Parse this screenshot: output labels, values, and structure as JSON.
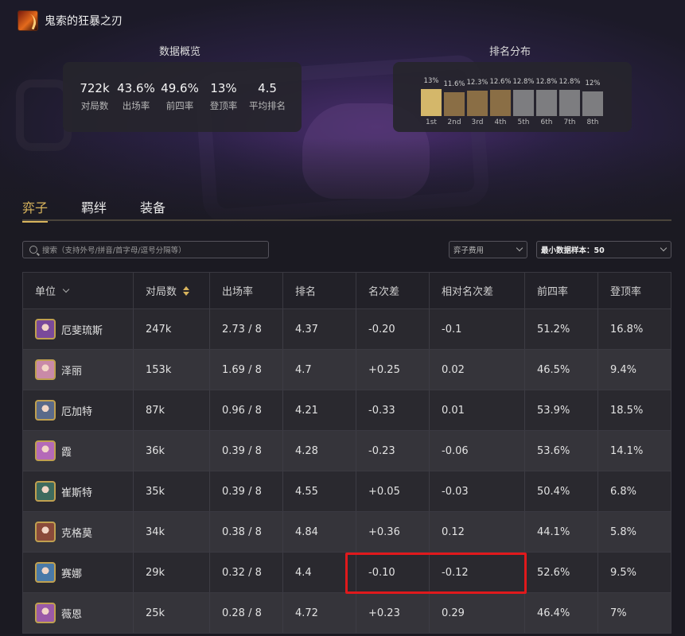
{
  "header": {
    "item_name": "鬼索的狂暴之刃"
  },
  "overview": {
    "title": "数据概览",
    "stats": [
      {
        "value": "722k",
        "label": "对局数"
      },
      {
        "value": "43.6%",
        "label": "出场率"
      },
      {
        "value": "49.6%",
        "label": "前四率"
      },
      {
        "value": "13%",
        "label": "登顶率"
      },
      {
        "value": "4.5",
        "label": "平均排名"
      }
    ]
  },
  "distribution": {
    "title": "排名分布",
    "items": [
      {
        "pct": "13%",
        "rank": "1st",
        "color": "#d4b76a",
        "fill": 13.0
      },
      {
        "pct": "11.6%",
        "rank": "2nd",
        "color": "#8a6e45",
        "fill": 11.6
      },
      {
        "pct": "12.3%",
        "rank": "3rd",
        "color": "#8a6e45",
        "fill": 12.3
      },
      {
        "pct": "12.6%",
        "rank": "4th",
        "color": "#8a6e45",
        "fill": 12.6
      },
      {
        "pct": "12.8%",
        "rank": "5th",
        "color": "#7d7d80",
        "fill": 12.8
      },
      {
        "pct": "12.8%",
        "rank": "6th",
        "color": "#7d7d80",
        "fill": 12.8
      },
      {
        "pct": "12.8%",
        "rank": "7th",
        "color": "#7d7d80",
        "fill": 12.8
      },
      {
        "pct": "12%",
        "rank": "8th",
        "color": "#7d7d80",
        "fill": 12.0
      }
    ]
  },
  "tabs": [
    "弈子",
    "羁绊",
    "装备"
  ],
  "filters": {
    "search_placeholder": "搜索（支持外号/拼音/首字母/逗号分隔等）",
    "cost_select": "弈子费用",
    "sample_select": "最小数据样本：50"
  },
  "table": {
    "headers": [
      "单位",
      "对局数",
      "出场率",
      "排名",
      "名次差",
      "相对名次差",
      "前四率",
      "登顶率"
    ],
    "rows": [
      {
        "name": "厄斐琉斯",
        "games": "247k",
        "rate": "2.73 / 8",
        "rank": "4.37",
        "diff": "-0.20",
        "rel": "-0.1",
        "top4": "51.2%",
        "win": "16.8%",
        "avatar": "#7a4a9a"
      },
      {
        "name": "泽丽",
        "games": "153k",
        "rate": "1.69 / 8",
        "rank": "4.7",
        "diff": "+0.25",
        "rel": "0.02",
        "top4": "46.5%",
        "win": "9.4%",
        "avatar": "#c98aa8"
      },
      {
        "name": "厄加特",
        "games": "87k",
        "rate": "0.96 / 8",
        "rank": "4.21",
        "diff": "-0.33",
        "rel": "0.01",
        "top4": "53.9%",
        "win": "18.5%",
        "avatar": "#5a6a8a"
      },
      {
        "name": "霞",
        "games": "36k",
        "rate": "0.39 / 8",
        "rank": "4.28",
        "diff": "-0.23",
        "rel": "-0.06",
        "top4": "53.6%",
        "win": "14.1%",
        "avatar": "#b46ab8"
      },
      {
        "name": "崔斯特",
        "games": "35k",
        "rate": "0.39 / 8",
        "rank": "4.55",
        "diff": "+0.05",
        "rel": "-0.03",
        "top4": "50.4%",
        "win": "6.8%",
        "avatar": "#3e6b5e"
      },
      {
        "name": "克格莫",
        "games": "34k",
        "rate": "0.38 / 8",
        "rank": "4.84",
        "diff": "+0.36",
        "rel": "0.12",
        "top4": "44.1%",
        "win": "5.8%",
        "avatar": "#8a4a3a"
      },
      {
        "name": "赛娜",
        "games": "29k",
        "rate": "0.32 / 8",
        "rank": "4.4",
        "diff": "-0.10",
        "rel": "-0.12",
        "top4": "52.6%",
        "win": "9.5%",
        "avatar": "#4a7aa8"
      },
      {
        "name": "薇恩",
        "games": "25k",
        "rate": "0.28 / 8",
        "rank": "4.72",
        "diff": "+0.23",
        "rel": "0.29",
        "top4": "46.4%",
        "win": "7%",
        "avatar": "#9a5aa8"
      }
    ]
  }
}
